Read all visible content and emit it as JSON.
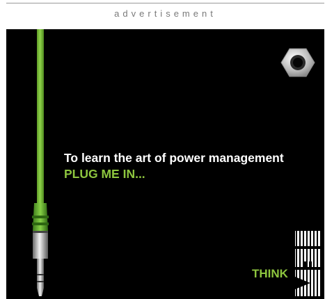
{
  "header": {
    "label": "advertisement"
  },
  "ad": {
    "headline": "To learn the art of power management",
    "call_to_action": "PLUG ME IN...",
    "slogan": "THINK",
    "logo_text": "IBM",
    "colors": {
      "background": "#000000",
      "accent_green": "#8ec63f",
      "cable_green": "#7cc43a",
      "headline_white": "#ffffff",
      "label_gray": "#7a7a7a"
    },
    "icons": [
      "audio-jack-plug-icon",
      "jack-socket-icon",
      "ibm-logo-icon"
    ]
  }
}
